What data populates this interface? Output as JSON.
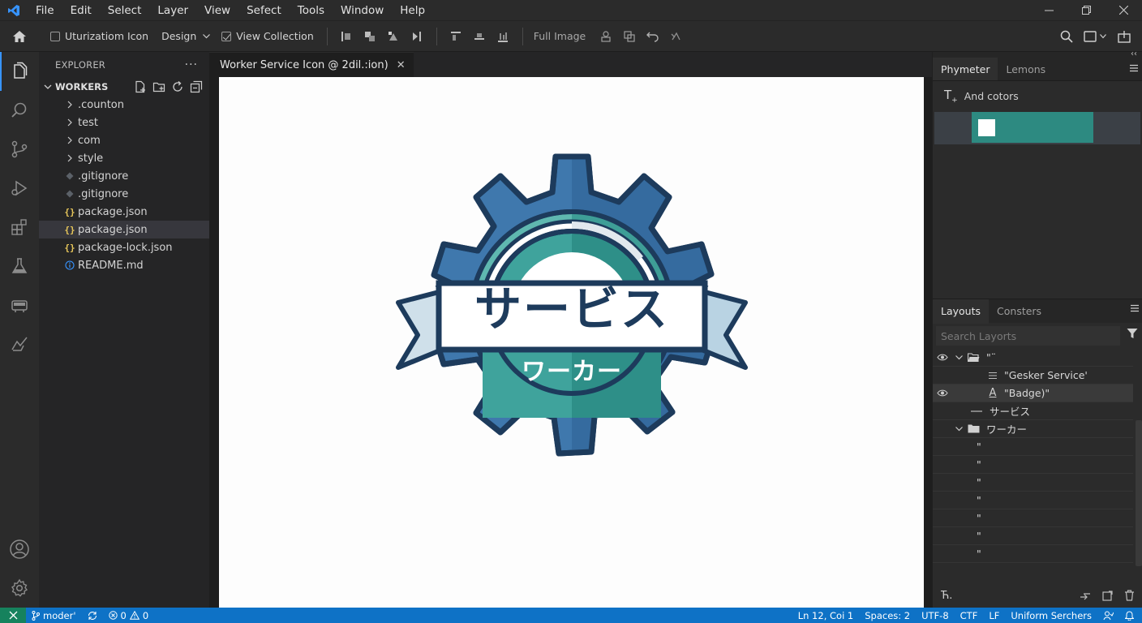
{
  "menubar": {
    "items": [
      "File",
      "Edit",
      "Select",
      "Layer",
      "View",
      "Sefect",
      "Tools",
      "Window",
      "Help"
    ]
  },
  "toolbar": {
    "checkbox1_label": "Uturizatiom Icon",
    "design_label": "Design",
    "checkbox2_label": "View Collection",
    "full_image_label": "Full Image"
  },
  "explorer": {
    "title": "EXPLORER",
    "workspace": "WORKERS",
    "items": [
      {
        "label": ".counton",
        "type": "folder"
      },
      {
        "label": "test",
        "type": "folder"
      },
      {
        "label": "com",
        "type": "folder"
      },
      {
        "label": "style",
        "type": "folder"
      },
      {
        "label": ".gitignore",
        "type": "git"
      },
      {
        "label": ".gitignore",
        "type": "git"
      },
      {
        "label": "package.json",
        "type": "json"
      },
      {
        "label": "package.json",
        "type": "json",
        "selected": true
      },
      {
        "label": "package-lock.json",
        "type": "json"
      },
      {
        "label": "README.md",
        "type": "info"
      }
    ]
  },
  "editor": {
    "tab_title": "Worker Service Icon @ 2dil.:ion)",
    "logo_main_text": "サービス",
    "logo_sub_text": "ワーカー"
  },
  "right_panel": {
    "tabs": [
      "Phymeter",
      "Lemons"
    ],
    "fill_label": "And cotors",
    "swatch_color": "#2d8a81",
    "layers_tabs": [
      "Layouts",
      "Consters"
    ],
    "search_placeholder": "Search Layorts",
    "layers": [
      {
        "label": "\"¨",
        "indent": 1,
        "icon": "folder-open",
        "eye": true,
        "chev": true
      },
      {
        "label": "\"Gesker Service'",
        "indent": 3,
        "icon": "text-lines",
        "eye": false
      },
      {
        "label": "\"Badge)\"",
        "indent": 3,
        "icon": "text-a",
        "eye": true,
        "selected": true
      },
      {
        "label": "サービス",
        "indent": 2,
        "icon": "dash",
        "eye": false
      },
      {
        "label": "ワーカー",
        "indent": 1,
        "icon": "folder",
        "eye": false,
        "chev": true
      },
      {
        "label": "\"",
        "indent": 3,
        "icon": "none",
        "eye": false
      },
      {
        "label": "\"",
        "indent": 3,
        "icon": "none",
        "eye": false
      },
      {
        "label": "\"",
        "indent": 3,
        "icon": "none",
        "eye": false
      },
      {
        "label": "\"",
        "indent": 3,
        "icon": "none",
        "eye": false
      },
      {
        "label": "\"",
        "indent": 3,
        "icon": "none",
        "eye": false
      },
      {
        "label": "\"",
        "indent": 3,
        "icon": "none",
        "eye": false
      },
      {
        "label": "\"",
        "indent": 3,
        "icon": "none",
        "eye": false
      }
    ]
  },
  "statusbar": {
    "branch": "moder'",
    "errors": "0",
    "warnings": "0",
    "position": "Ln 12, Coi 1",
    "spaces": "Spaces: 2",
    "encoding": "UTF-8",
    "ctf": "CTF",
    "eol": "LF",
    "language": "Uniform Serchers"
  },
  "colors": {
    "accent": "#0e72c6",
    "gear_blue": "#3f78ad",
    "gear_teal": "#2e8f88",
    "outline": "#1d3b5c"
  }
}
